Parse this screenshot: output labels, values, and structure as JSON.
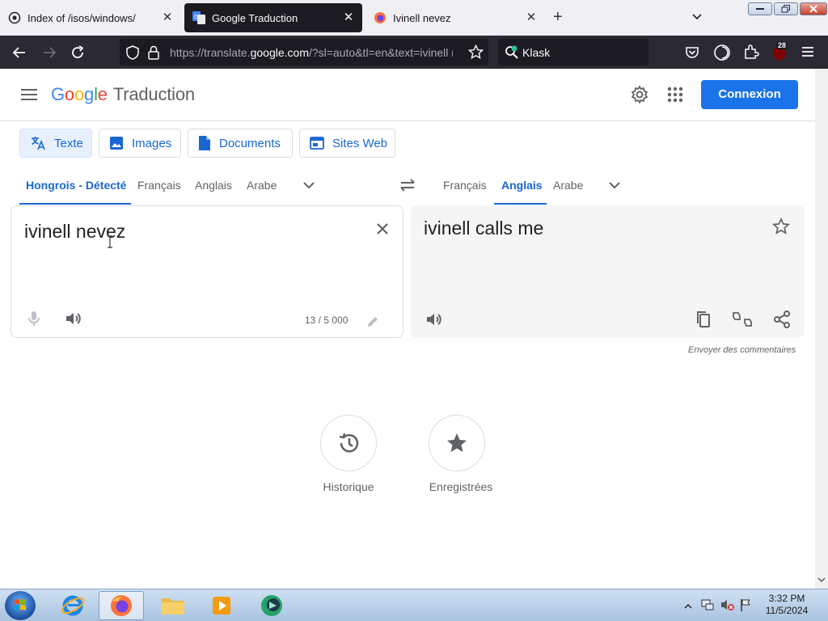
{
  "browser": {
    "tabs": [
      {
        "title": "Index of /isos/windows/",
        "active": false
      },
      {
        "title": "Google Traduction",
        "active": true
      },
      {
        "title": "Ivinell nevez",
        "active": false
      }
    ],
    "url_prefix": "https://translate.",
    "url_domain": "google.com",
    "url_suffix": "/?sl=auto&tl=en&text=ivinell n",
    "search_text": "Klask",
    "extension_badge": "28"
  },
  "translate": {
    "logo_letters": [
      "G",
      "o",
      "o",
      "g",
      "l",
      "e"
    ],
    "product_name": "Traduction",
    "signin_label": "Connexion",
    "modes": [
      "Texte",
      "Images",
      "Documents",
      "Sites Web"
    ],
    "source_langs": [
      "Hongrois - Détecté",
      "Français",
      "Anglais",
      "Arabe"
    ],
    "target_langs": [
      "Français",
      "Anglais",
      "Arabe"
    ],
    "source_text": "ivinell nevez",
    "translated_text": "ivinell calls me",
    "char_count": "13 / 5 000",
    "feedback_label": "Envoyer des commentaires",
    "history_label": "Historique",
    "saved_label": "Enregistrées"
  },
  "taskbar": {
    "time": "3:32 PM",
    "date": "11/5/2024"
  }
}
